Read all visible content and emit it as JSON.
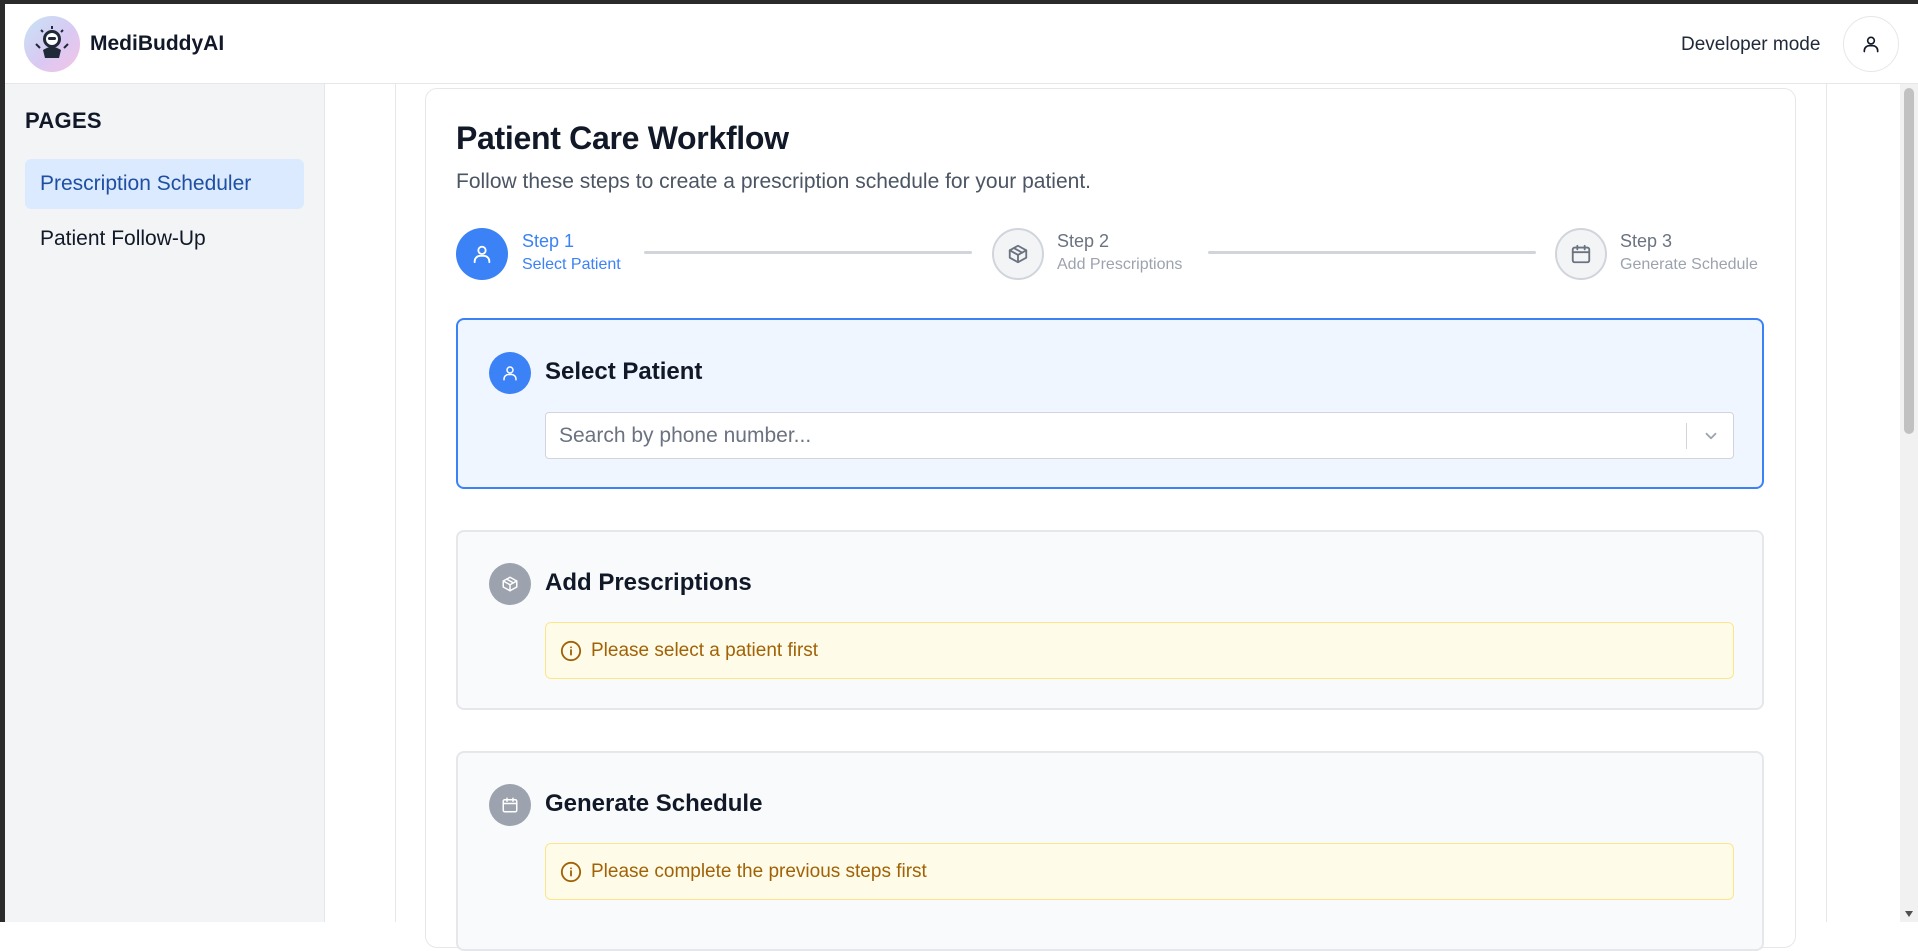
{
  "app": {
    "name": "MediBuddyAI",
    "developer_mode_label": "Developer mode"
  },
  "sidebar": {
    "title": "PAGES",
    "items": [
      {
        "label": "Prescription Scheduler",
        "active": true
      },
      {
        "label": "Patient Follow-Up",
        "active": false
      }
    ]
  },
  "main": {
    "title": "Patient Care Workflow",
    "subtitle": "Follow these steps to create a prescription schedule for your patient.",
    "steps": [
      {
        "label": "Step 1",
        "sub": "Select Patient",
        "icon": "user-icon",
        "active": true
      },
      {
        "label": "Step 2",
        "sub": "Add Prescriptions",
        "icon": "package-icon",
        "active": false
      },
      {
        "label": "Step 3",
        "sub": "Generate Schedule",
        "icon": "calendar-icon",
        "active": false
      }
    ],
    "sections": {
      "select_patient": {
        "title": "Select Patient",
        "search_placeholder": "Search by phone number..."
      },
      "add_prescriptions": {
        "title": "Add Prescriptions",
        "notice": "Please select a patient first"
      },
      "generate_schedule": {
        "title": "Generate Schedule",
        "notice": "Please complete the previous steps first"
      }
    }
  },
  "colors": {
    "accent": "#3b82f6",
    "active_nav_bg": "#dbeafe",
    "notice_bg": "#fefce8",
    "notice_text": "#a16207"
  }
}
